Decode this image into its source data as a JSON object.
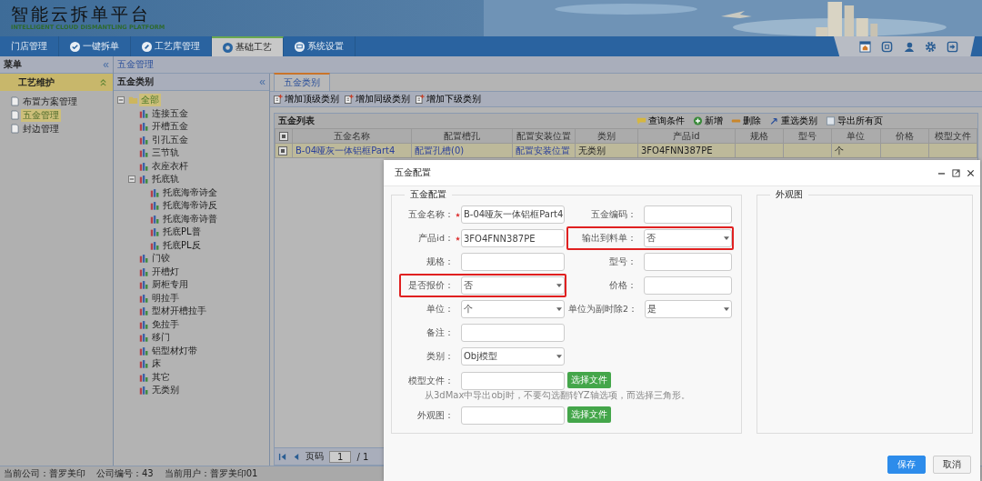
{
  "header": {
    "title": "智能云拆单平台",
    "subtitle": "INTELLIGENT CLOUD DISMANTLING PLATFORM"
  },
  "nav": {
    "tabs": [
      {
        "label": "门店管理",
        "selected": false
      },
      {
        "label": "一键拆单",
        "selected": false
      },
      {
        "label": "工艺库管理",
        "selected": false
      },
      {
        "label": "基础工艺",
        "selected": true
      },
      {
        "label": "系统设置",
        "selected": false
      }
    ]
  },
  "menu": {
    "title": "菜单",
    "collapse": "«",
    "section": {
      "title": "工艺维护",
      "expanded": true,
      "items": [
        {
          "label": "布置方案管理",
          "selected": false
        },
        {
          "label": "五金管理",
          "selected": true
        },
        {
          "label": "封边管理",
          "selected": false
        }
      ]
    }
  },
  "breadcrumb": "五金管理",
  "category_panel": {
    "title": "五金类别",
    "collapse": "«",
    "tree": [
      {
        "label": "全部",
        "kind": "folder",
        "selected": true,
        "expanded": true,
        "children": [
          {
            "label": "连接五金",
            "kind": "leaf",
            "selected": false
          },
          {
            "label": "开槽五金",
            "kind": "leaf",
            "selected": false
          },
          {
            "label": "引孔五金",
            "kind": "leaf",
            "selected": false
          },
          {
            "label": "三节轨",
            "kind": "leaf",
            "selected": false
          },
          {
            "label": "衣座衣杆",
            "kind": "leaf",
            "selected": false
          },
          {
            "label": "托底轨",
            "kind": "leaf",
            "selected": false,
            "expanded": true,
            "children": [
              {
                "label": "托底海帝诗全",
                "kind": "leaf",
                "selected": false
              },
              {
                "label": "托底海帝诗反",
                "kind": "leaf",
                "selected": false
              },
              {
                "label": "托底海帝诗普",
                "kind": "leaf",
                "selected": false
              },
              {
                "label": "托底PL普",
                "kind": "leaf",
                "selected": false
              },
              {
                "label": "托底PL反",
                "kind": "leaf",
                "selected": false
              }
            ]
          },
          {
            "label": "门铰",
            "kind": "leaf",
            "selected": false
          },
          {
            "label": "开槽灯",
            "kind": "leaf",
            "selected": false
          },
          {
            "label": "厨柜专用",
            "kind": "leaf",
            "selected": false
          },
          {
            "label": "明拉手",
            "kind": "leaf",
            "selected": false
          },
          {
            "label": "型材开槽拉手",
            "kind": "leaf",
            "selected": false
          },
          {
            "label": "免拉手",
            "kind": "leaf",
            "selected": false
          },
          {
            "label": "移门",
            "kind": "leaf",
            "selected": false
          },
          {
            "label": "铝型材灯带",
            "kind": "leaf",
            "selected": false
          },
          {
            "label": "床",
            "kind": "leaf",
            "selected": false
          },
          {
            "label": "其它",
            "kind": "leaf",
            "selected": false
          },
          {
            "label": "无类别",
            "kind": "leaf",
            "selected": false
          }
        ]
      }
    ]
  },
  "content_tabs": [
    {
      "label": "五金类别",
      "selected": true
    }
  ],
  "toolbar": [
    "增加顶级类别",
    "增加同级类别",
    "增加下级类别"
  ],
  "grid": {
    "title": "五金列表",
    "actions": [
      "查询条件",
      "新增",
      "删除",
      "重选类别",
      "导出所有页"
    ],
    "header_checked": true,
    "columns": [
      "五金名称",
      "配置槽孔",
      "配置安装位置",
      "类别",
      "产品id",
      "规格",
      "型号",
      "单位",
      "价格",
      "模型文件"
    ],
    "rows": [
      {
        "checked": true,
        "selected": true,
        "cells": [
          "B-04哑灰一体铝框Part4",
          "配置孔槽(0)",
          "配置安装位置",
          "无类别",
          "3FO4FNN387PE",
          "",
          "",
          "个",
          "",
          ""
        ]
      }
    ],
    "pager": {
      "label": "页码",
      "page": "1",
      "total": "/ 1"
    }
  },
  "status_bar": [
    "当前公司：普罗美印",
    "公司编号：43",
    "当前用户：普罗美印01"
  ],
  "dialog": {
    "title": "五金配置",
    "legend": "五金配置",
    "side_legend": "外观图",
    "rows": [
      [
        {
          "kind": "text",
          "label": "五金名称：",
          "required": true,
          "highlighted": false,
          "value": "B-04哑灰一体铝框Part4"
        },
        {
          "kind": "text",
          "label": "五金编码：",
          "required": false,
          "highlighted": false
        }
      ],
      [
        {
          "kind": "text",
          "label": "产品id：",
          "required": true,
          "highlighted": false,
          "value": "3FO4FNN387PE"
        },
        {
          "kind": "select",
          "label": "输出到料单：",
          "required": false,
          "highlighted": true,
          "value": "否"
        }
      ],
      [
        {
          "kind": "text",
          "label": "规格：",
          "required": false,
          "highlighted": false
        },
        {
          "kind": "text",
          "label": "型号：",
          "required": false,
          "highlighted": false
        }
      ],
      [
        {
          "kind": "select",
          "label": "是否报价：",
          "required": false,
          "highlighted": true,
          "value": "否"
        },
        {
          "kind": "text",
          "label": "价格：",
          "required": false,
          "highlighted": false
        }
      ],
      [
        {
          "kind": "select",
          "label": "单位：",
          "required": false,
          "highlighted": false,
          "value": "个"
        },
        {
          "kind": "select",
          "label": "单位为副时除2：",
          "required": false,
          "highlighted": false,
          "value": "是"
        }
      ],
      [
        {
          "kind": "textarea",
          "label": "备注：",
          "required": false,
          "highlighted": false
        }
      ],
      [
        {
          "kind": "select",
          "label": "类别：",
          "required": false,
          "highlighted": false,
          "value": "Obj模型"
        }
      ],
      [
        {
          "kind": "file",
          "label": "模型文件：",
          "required": false,
          "highlighted": false,
          "button": "选择文件",
          "hint": "从3dMax中导出obj时，不要勾选翻转YZ轴选项，而选择三角形。"
        }
      ],
      [
        {
          "kind": "file",
          "label": "外观图：",
          "required": false,
          "highlighted": false,
          "button": "选择文件"
        }
      ]
    ],
    "buttons": [
      {
        "label": "保存",
        "kind": "primary"
      },
      {
        "label": "取消",
        "kind": "secondary"
      }
    ]
  }
}
